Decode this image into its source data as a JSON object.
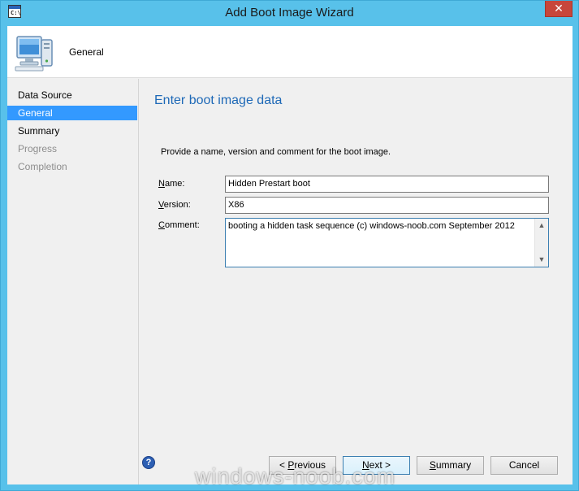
{
  "window": {
    "title": "Add Boot Image Wizard",
    "icon_text": "C:\\",
    "close_glyph": "✕"
  },
  "header": {
    "title": "General",
    "icon": "computer-icon"
  },
  "nav": {
    "items": [
      {
        "label": "Data Source",
        "state": "normal"
      },
      {
        "label": "General",
        "state": "selected"
      },
      {
        "label": "Summary",
        "state": "normal"
      },
      {
        "label": "Progress",
        "state": "disabled"
      },
      {
        "label": "Completion",
        "state": "disabled"
      }
    ]
  },
  "page": {
    "heading": "Enter boot image data",
    "instructions": "Provide a name, version and comment for the boot image.",
    "fields": {
      "name": {
        "label_mnemonic": "N",
        "label_rest": "ame:",
        "value": "Hidden Prestart boot"
      },
      "version": {
        "label_mnemonic": "V",
        "label_rest": "ersion:",
        "value": "X86"
      },
      "comment": {
        "label_mnemonic": "C",
        "label_rest": "omment:",
        "value": "booting a hidden task sequence (c) windows-noob.com September 2012"
      }
    }
  },
  "footer": {
    "help_glyph": "?",
    "buttons": {
      "previous_prefix": "< ",
      "previous_mnemonic": "P",
      "previous_rest": "revious",
      "next_mnemonic": "N",
      "next_rest": "ext >",
      "summary_mnemonic": "S",
      "summary_rest": "ummary",
      "cancel": "Cancel"
    }
  },
  "watermark": "windows-noob.com",
  "colors": {
    "titlebar": "#58c1ea",
    "selection": "#3399ff",
    "heading": "#1e69b7",
    "close": "#c7463b"
  }
}
